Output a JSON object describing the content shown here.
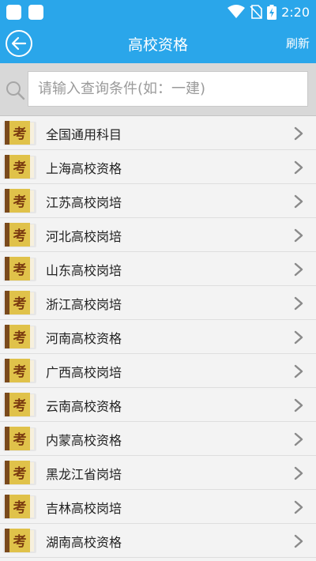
{
  "status": {
    "time": "2:20"
  },
  "header": {
    "title": "高校资格",
    "refresh_label": "刷新"
  },
  "search": {
    "placeholder": "请输入查询条件(如：一建)"
  },
  "book_glyph": "考",
  "items": [
    {
      "label": "全国通用科目"
    },
    {
      "label": "上海高校资格"
    },
    {
      "label": "江苏高校岗培"
    },
    {
      "label": "河北高校岗培"
    },
    {
      "label": "山东高校岗培"
    },
    {
      "label": "浙江高校岗培"
    },
    {
      "label": "河南高校资格"
    },
    {
      "label": "广西高校岗培"
    },
    {
      "label": "云南高校资格"
    },
    {
      "label": "内蒙高校资格"
    },
    {
      "label": "黑龙江省岗培"
    },
    {
      "label": "吉林高校岗培"
    },
    {
      "label": "湖南高校资格"
    }
  ],
  "colors": {
    "primary": "#2aa6ea",
    "book_cover": "#e0c24a",
    "book_spine": "#7a4a1c"
  }
}
